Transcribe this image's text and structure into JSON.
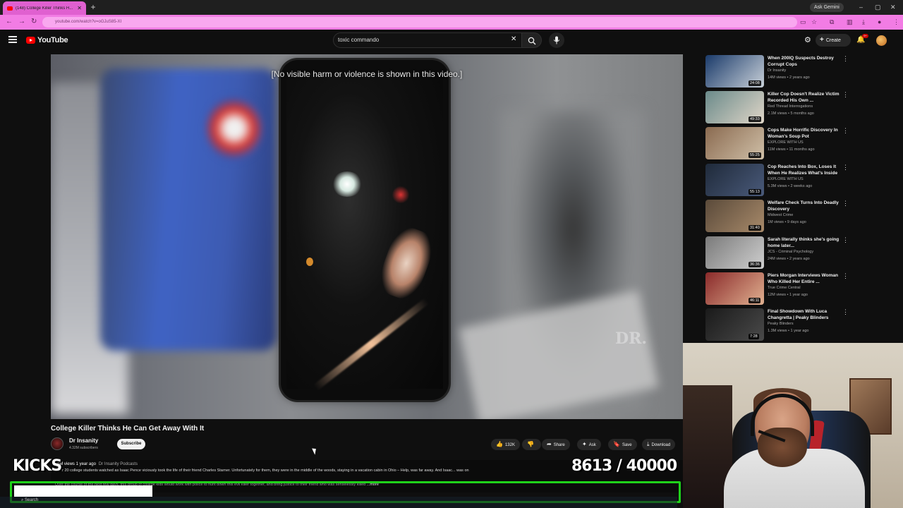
{
  "browser": {
    "tab_title": "(148) College Killer Thinks H...",
    "new_tab": "+",
    "gemini_label": "Ask Gemini",
    "url": "youtube.com/watch?v=oGJuS85-XI",
    "window_controls": [
      "–",
      "▢",
      "✕"
    ]
  },
  "header": {
    "logo_text": "YouTube",
    "search_value": "toxic commando",
    "clear_icon": "✕",
    "create_label": "Create",
    "notifications_badge": "9+"
  },
  "player": {
    "disclaimer": "[No visible harm or violence is shown in this video.]",
    "watermark": "DR."
  },
  "video": {
    "title": "College Killer Thinks He Can Get Away With It",
    "channel": "Dr Insanity",
    "subscribers": "4.32M subscribers",
    "subscribe_label": "Subscribe",
    "likes": "132K",
    "share_label": "Share",
    "ask_label": "Ask",
    "save_label": "Save",
    "download_label": "Download"
  },
  "description": {
    "meta": "11M views  1 year ago",
    "meta_tag": "Dr Insanity Podcasts",
    "line1": "Over 20 college students watched as Isaac Pence viciously took the life of their friend Charles Starner. Unfortunately for them, they were in the middle of the woods, staying in a vacation cabin in Ohio – Help, was far away. And Isaac... was on",
    "line2": "Over the course of the next few days, this group of college kids would work with police to hunt down this evil killer together, and bring justice to their friend who was senselessly killed",
    "more": "...more"
  },
  "overlay": {
    "kicks_label": "KICKS",
    "counter": "8613 / 40000",
    "counter_current": 8613,
    "counter_goal": 40000,
    "taskbar_search": "Search"
  },
  "sidebar": [
    {
      "title": "When 200IQ Suspects Destroy Corrupt Cops",
      "channel": "Dr Insanity",
      "stats": "14M views • 2 years ago",
      "duration": "24:08",
      "thumb_colors": [
        "#1a3a6a",
        "#c8d0d8"
      ]
    },
    {
      "title": "Killer Cop Doesn't Realize Victim Recorded His Own ...",
      "channel": "Red Thread Interrogations",
      "stats": "2.1M views • 5 months ago",
      "duration": "49:33",
      "thumb_colors": [
        "#6a8a8a",
        "#e0d6c8"
      ]
    },
    {
      "title": "Cops Make Horrific Discovery In Woman's Soup Pot",
      "channel": "EXPLORE WITH US",
      "stats": "11M views • 11 months ago",
      "duration": "55:25",
      "thumb_colors": [
        "#8a6a50",
        "#d0c0a8"
      ]
    },
    {
      "title": "Cop Reaches Into Box, Loses It When He Realizes What's Inside",
      "channel": "EXPLORE WITH US",
      "stats": "5.3M views • 2 weeks ago",
      "duration": "55:13",
      "thumb_colors": [
        "#1f2a3a",
        "#4a5a7a"
      ]
    },
    {
      "title": "Welfare Check Turns Into Deadly Discovery",
      "channel": "Midwest Crime",
      "stats": "1M views • 9 days ago",
      "duration": "31:40",
      "thumb_colors": [
        "#5a4a3a",
        "#a88a6a"
      ]
    },
    {
      "title": "Sarah literally thinks she's going home later...",
      "channel": "JCS - Criminal Psychology",
      "stats": "24M views • 2 years ago",
      "duration": "36:36",
      "thumb_colors": [
        "#7a7a7a",
        "#cfcfcf"
      ]
    },
    {
      "title": "Piers Morgan Interviews Woman Who Killed Her Entire ...",
      "channel": "True Crime Central",
      "stats": "12M views • 1 year ago",
      "duration": "46:11",
      "thumb_colors": [
        "#8a2a2a",
        "#e0b090"
      ]
    },
    {
      "title": "Final Showdown With Luca Changretta | Peaky Blinders",
      "channel": "Peaky Blinders",
      "stats": "1.3M views • 1 year ago",
      "duration": "7:28",
      "thumb_colors": [
        "#1a1a1a",
        "#4a4a4a"
      ]
    }
  ]
}
